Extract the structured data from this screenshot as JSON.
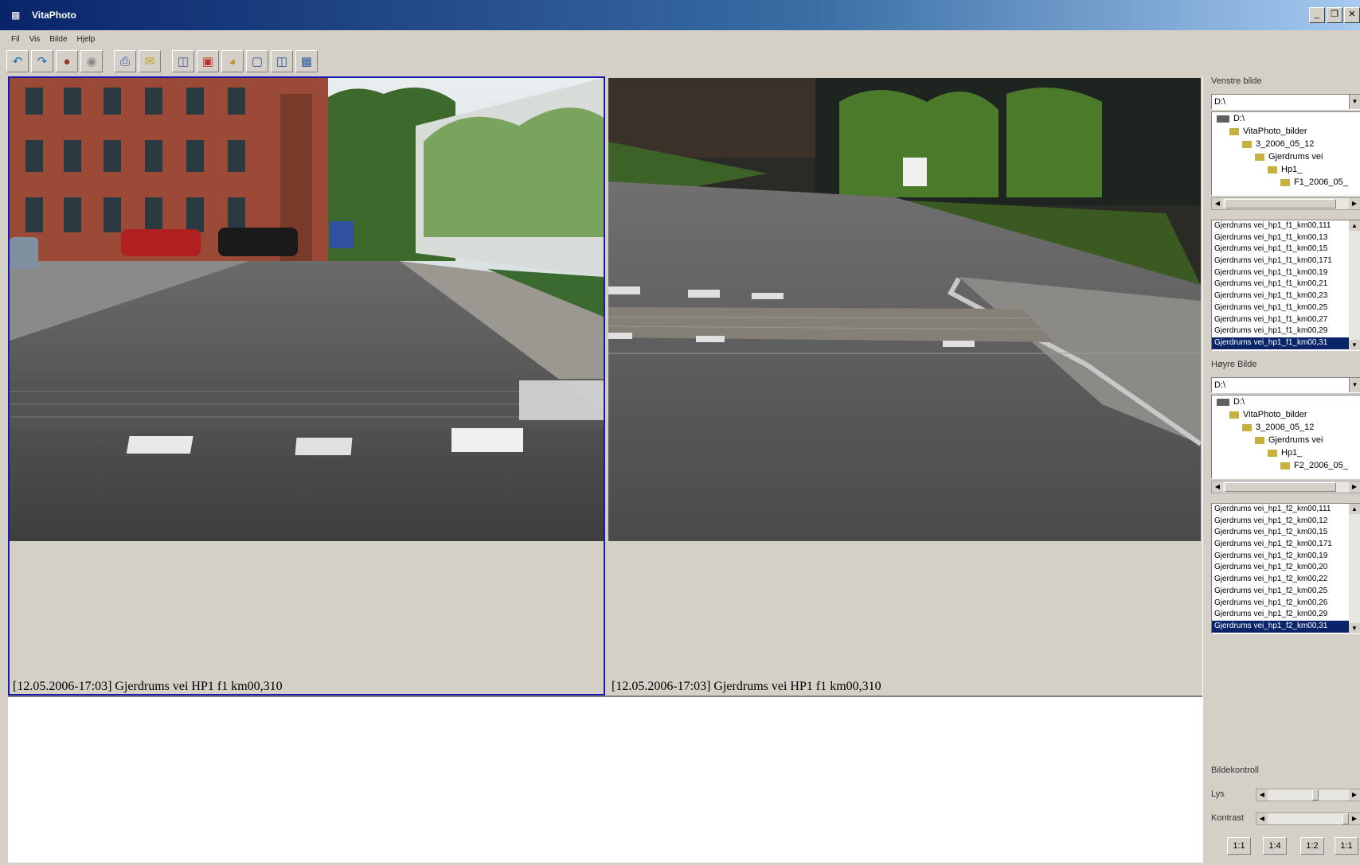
{
  "window": {
    "title": "VitaPhoto"
  },
  "menu": [
    "Fil",
    "Vis",
    "Bilde",
    "Hjelp"
  ],
  "toolbar": {
    "buttons": [
      "back-icon",
      "forward-icon",
      "camera-icon",
      "disc-icon",
      "print-icon",
      "mail-icon",
      "database-icon",
      "document-icon",
      "globe-icon",
      "single-view-icon",
      "dual-view-icon",
      "quad-view-icon"
    ]
  },
  "viewer": {
    "left_caption": "[12.05.2006-17:03]  Gjerdrums vei HP1 f1 km00,310",
    "right_caption": "[12.05.2006-17:03]  Gjerdrums vei HP1 f1 km00,310"
  },
  "left_image": {
    "label": "Venstre bilde",
    "drive": "D:\\",
    "tree": [
      "D:\\",
      "VitaPhoto_bilder",
      "3_2006_05_12",
      "Gjerdrums vei",
      "Hp1_",
      "F1_2006_05_"
    ],
    "files": [
      "Gjerdrums vei_hp1_f1_km00,111",
      "Gjerdrums vei_hp1_f1_km00,13",
      "Gjerdrums vei_hp1_f1_km00,15",
      "Gjerdrums vei_hp1_f1_km00,171",
      "Gjerdrums vei_hp1_f1_km00,19",
      "Gjerdrums vei_hp1_f1_km00,21",
      "Gjerdrums vei_hp1_f1_km00,23",
      "Gjerdrums vei_hp1_f1_km00,25",
      "Gjerdrums vei_hp1_f1_km00,27",
      "Gjerdrums vei_hp1_f1_km00,29",
      "Gjerdrums vei_hp1_f1_km00,31"
    ]
  },
  "right_image": {
    "label": "Høyre Bilde",
    "drive": "D:\\",
    "tree": [
      "D:\\",
      "VitaPhoto_bilder",
      "3_2006_05_12",
      "Gjerdrums vei",
      "Hp1_",
      "F2_2006_05_"
    ],
    "files": [
      "Gjerdrums vei_hp1_f2_km00,111",
      "Gjerdrums vei_hp1_f2_km00,12",
      "Gjerdrums vei_hp1_f2_km00,15",
      "Gjerdrums vei_hp1_f2_km00,171",
      "Gjerdrums vei_hp1_f2_km00,19",
      "Gjerdrums vei_hp1_f2_km00,20",
      "Gjerdrums vei_hp1_f2_km00,22",
      "Gjerdrums vei_hp1_f2_km00,25",
      "Gjerdrums vei_hp1_f2_km00,26",
      "Gjerdrums vei_hp1_f2_km00,29",
      "Gjerdrums vei_hp1_f2_km00,31"
    ]
  },
  "image_control": {
    "label": "Bildekontroll",
    "brightness_label": "Lys",
    "contrast_label": "Kontrast",
    "zoom_buttons": [
      "1:1",
      "1:4",
      "1:2",
      "1:1"
    ]
  },
  "colors": {
    "selection": "#0a246a",
    "active_pane_border": "#1a1ab0",
    "title_gradient_start": "#0a246a"
  }
}
